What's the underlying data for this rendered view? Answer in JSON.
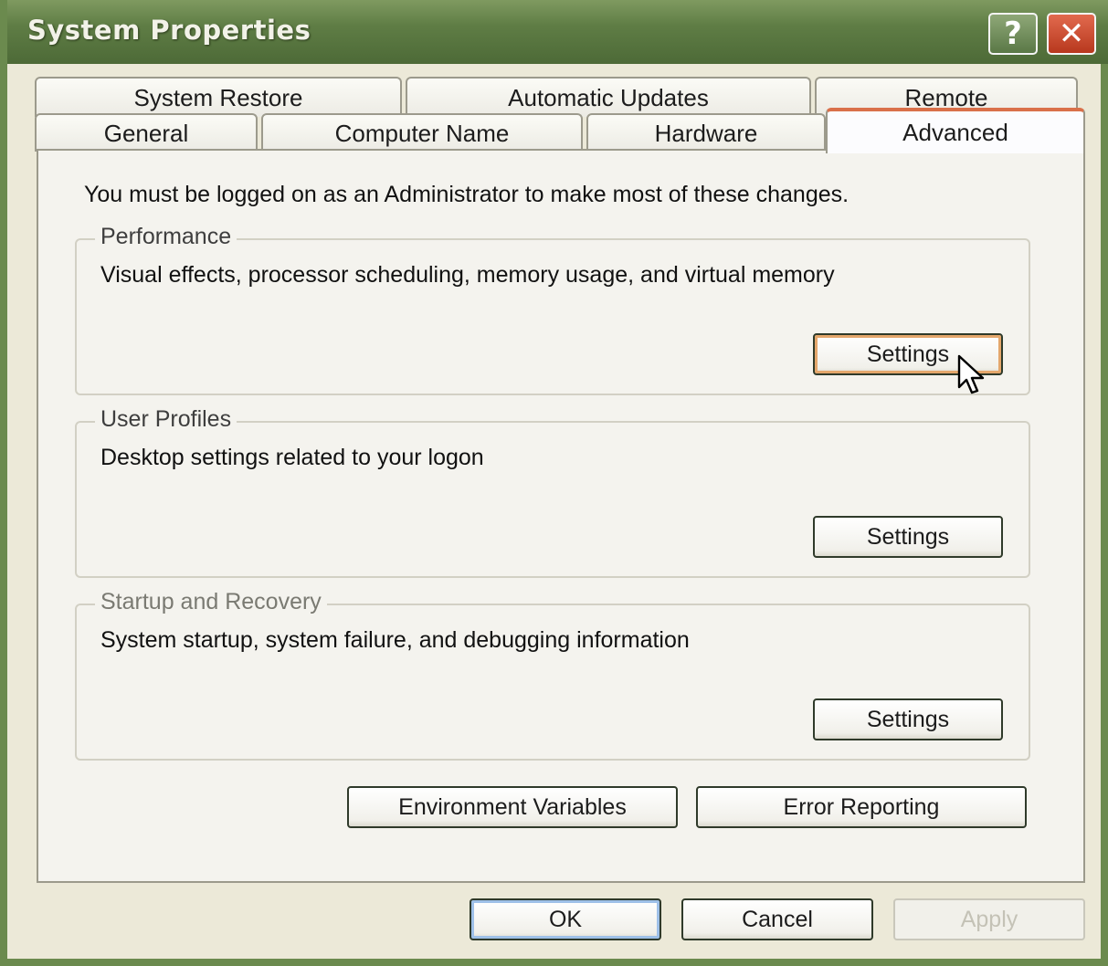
{
  "window": {
    "title": "System Properties",
    "help_label": "?",
    "close_label": "✕"
  },
  "tabs": {
    "row_back": [
      {
        "label": "System Restore"
      },
      {
        "label": "Automatic Updates"
      },
      {
        "label": "Remote"
      }
    ],
    "row_front": [
      {
        "label": "General"
      },
      {
        "label": "Computer Name"
      },
      {
        "label": "Hardware"
      },
      {
        "label": "Advanced"
      }
    ],
    "active": "Advanced"
  },
  "advanced": {
    "intro": "You must be logged on as an Administrator to make most of these changes.",
    "performance": {
      "title": "Performance",
      "description": "Visual effects, processor scheduling, memory usage, and virtual memory",
      "button": "Settings"
    },
    "user_profiles": {
      "title": "User Profiles",
      "description": "Desktop settings related to your logon",
      "button": "Settings"
    },
    "startup_recovery": {
      "title": "Startup and Recovery",
      "description": "System startup, system failure, and debugging information",
      "button": "Settings"
    },
    "environment_variables": "Environment Variables",
    "error_reporting": "Error Reporting"
  },
  "footer": {
    "ok": "OK",
    "cancel": "Cancel",
    "apply": "Apply"
  },
  "colors": {
    "titlebar": "#5f7d45",
    "dialog_bg": "#ece9d8",
    "active_tab_accent": "#d9704a",
    "close_button": "#c8452a"
  },
  "icons": {
    "cursor": "arrow-cursor-icon"
  }
}
